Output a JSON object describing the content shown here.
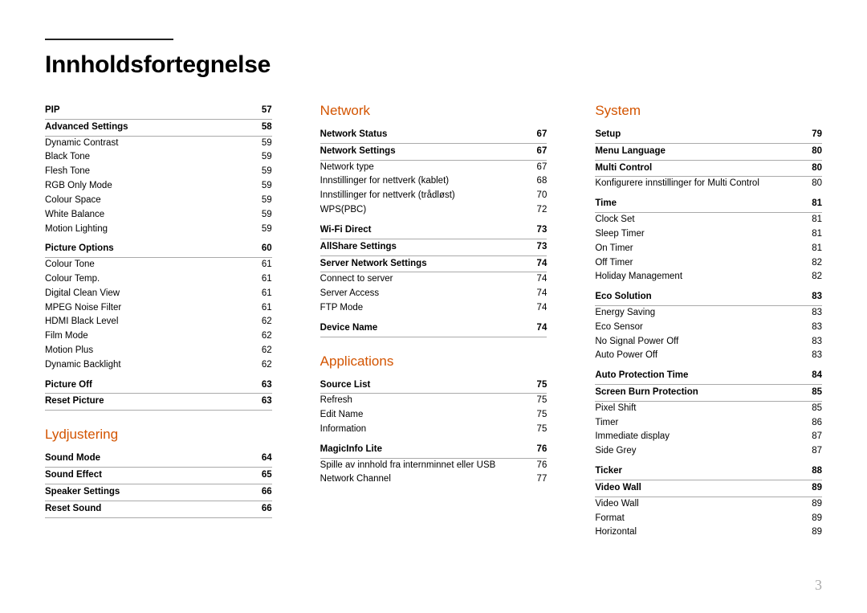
{
  "title": "Innholdsfortegnelse",
  "page_number": "3",
  "columns": [
    {
      "sections": [
        {
          "heading": null,
          "entries": [
            {
              "label": "PIP",
              "page": "57",
              "bold": true
            },
            {
              "label": "Advanced Settings",
              "page": "58",
              "bold": true
            },
            {
              "label": "Dynamic Contrast",
              "page": "59"
            },
            {
              "label": "Black Tone",
              "page": "59"
            },
            {
              "label": "Flesh Tone",
              "page": "59"
            },
            {
              "label": "RGB Only Mode",
              "page": "59"
            },
            {
              "label": "Colour Space",
              "page": "59"
            },
            {
              "label": "White Balance",
              "page": "59"
            },
            {
              "label": "Motion Lighting",
              "page": "59"
            },
            {
              "label": "Picture Options",
              "page": "60",
              "bold": true
            },
            {
              "label": "Colour Tone",
              "page": "61"
            },
            {
              "label": "Colour Temp.",
              "page": "61"
            },
            {
              "label": "Digital Clean View",
              "page": "61"
            },
            {
              "label": "MPEG Noise Filter",
              "page": "61"
            },
            {
              "label": "HDMI Black Level",
              "page": "62"
            },
            {
              "label": "Film Mode",
              "page": "62"
            },
            {
              "label": "Motion Plus",
              "page": "62"
            },
            {
              "label": "Dynamic Backlight",
              "page": "62"
            },
            {
              "label": "Picture Off",
              "page": "63",
              "bold": true
            },
            {
              "label": "Reset Picture",
              "page": "63",
              "bold": true
            }
          ]
        },
        {
          "heading": "Lydjustering",
          "entries": [
            {
              "label": "Sound Mode",
              "page": "64",
              "bold": true
            },
            {
              "label": "Sound Effect",
              "page": "65",
              "bold": true
            },
            {
              "label": "Speaker Settings",
              "page": "66",
              "bold": true
            },
            {
              "label": "Reset Sound",
              "page": "66",
              "bold": true
            }
          ]
        }
      ]
    },
    {
      "sections": [
        {
          "heading": "Network",
          "entries": [
            {
              "label": "Network Status",
              "page": "67",
              "bold": true
            },
            {
              "label": "Network Settings",
              "page": "67",
              "bold": true
            },
            {
              "label": "Network type",
              "page": "67"
            },
            {
              "label": "Innstillinger for nettverk (kablet)",
              "page": "68"
            },
            {
              "label": "Innstillinger for nettverk (trådløst)",
              "page": "70"
            },
            {
              "label": "WPS(PBC)",
              "page": "72"
            },
            {
              "label": "Wi-Fi Direct",
              "page": "73",
              "bold": true
            },
            {
              "label": "AllShare Settings",
              "page": "73",
              "bold": true
            },
            {
              "label": "Server Network Settings",
              "page": "74",
              "bold": true
            },
            {
              "label": "Connect to server",
              "page": "74"
            },
            {
              "label": "Server Access",
              "page": "74"
            },
            {
              "label": "FTP Mode",
              "page": "74"
            },
            {
              "label": "Device Name",
              "page": "74",
              "bold": true
            }
          ]
        },
        {
          "heading": "Applications",
          "entries": [
            {
              "label": "Source List",
              "page": "75",
              "bold": true
            },
            {
              "label": "Refresh",
              "page": "75"
            },
            {
              "label": "Edit Name",
              "page": "75"
            },
            {
              "label": "Information",
              "page": "75"
            },
            {
              "label": "MagicInfo Lite",
              "page": "76",
              "bold": true
            },
            {
              "label": "Spille av innhold fra internminnet eller USB",
              "page": "76"
            },
            {
              "label": "Network Channel",
              "page": "77"
            }
          ]
        }
      ]
    },
    {
      "sections": [
        {
          "heading": "System",
          "entries": [
            {
              "label": "Setup",
              "page": "79",
              "bold": true
            },
            {
              "label": "Menu Language",
              "page": "80",
              "bold": true
            },
            {
              "label": "Multi Control",
              "page": "80",
              "bold": true
            },
            {
              "label": "Konfigurere innstillinger for Multi Control",
              "page": "80"
            },
            {
              "label": "Time",
              "page": "81",
              "bold": true
            },
            {
              "label": "Clock Set",
              "page": "81"
            },
            {
              "label": "Sleep Timer",
              "page": "81"
            },
            {
              "label": "On Timer",
              "page": "81"
            },
            {
              "label": "Off Timer",
              "page": "82"
            },
            {
              "label": "Holiday Management",
              "page": "82"
            },
            {
              "label": "Eco Solution",
              "page": "83",
              "bold": true
            },
            {
              "label": "Energy Saving",
              "page": "83"
            },
            {
              "label": "Eco Sensor",
              "page": "83"
            },
            {
              "label": "No Signal Power Off",
              "page": "83"
            },
            {
              "label": "Auto Power Off",
              "page": "83"
            },
            {
              "label": "Auto Protection Time",
              "page": "84",
              "bold": true
            },
            {
              "label": "Screen Burn Protection",
              "page": "85",
              "bold": true
            },
            {
              "label": "Pixel Shift",
              "page": "85"
            },
            {
              "label": "Timer",
              "page": "86"
            },
            {
              "label": "Immediate display",
              "page": "87"
            },
            {
              "label": "Side Grey",
              "page": "87"
            },
            {
              "label": "Ticker",
              "page": "88",
              "bold": true
            },
            {
              "label": "Video Wall",
              "page": "89",
              "bold": true
            },
            {
              "label": "Video Wall",
              "page": "89"
            },
            {
              "label": "Format",
              "page": "89"
            },
            {
              "label": "Horizontal",
              "page": "89"
            }
          ]
        }
      ]
    }
  ]
}
